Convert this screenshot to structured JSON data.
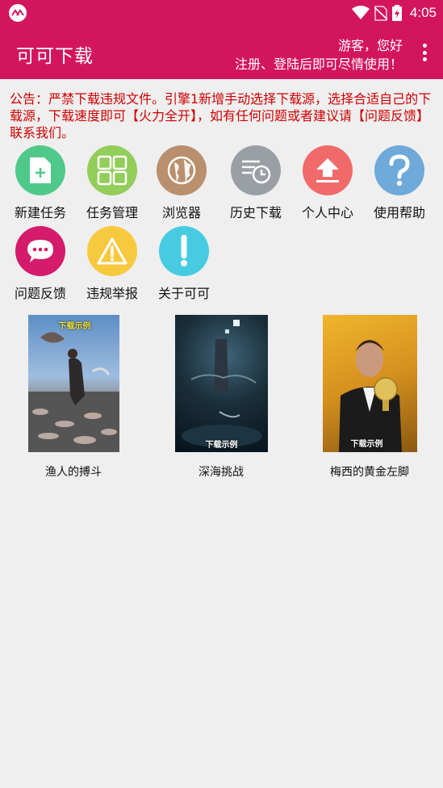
{
  "status_bar": {
    "time": "4:05",
    "icons": [
      "app-logo-icon",
      "wifi-icon",
      "no-sim-icon",
      "battery-charging-icon"
    ]
  },
  "app_bar": {
    "title": "可可下载",
    "greeting": "游客，您好",
    "login_hint": "注册、登陆后即可尽情使用！",
    "menu_icon": "more-vert-icon"
  },
  "notice": {
    "text": "公告：严禁下载违规文件。引擎1新增手动选择下载源，选择合适自己的下载源，下载速度即可【火力全开】，如有任何问题或者建议请【问题反馈】联系我们。"
  },
  "features": [
    {
      "label": "新建任务",
      "icon": "new-task-icon",
      "color": "#4fc98a"
    },
    {
      "label": "任务管理",
      "icon": "task-manage-icon",
      "color": "#93cd5a"
    },
    {
      "label": "浏览器",
      "icon": "globe-icon",
      "color": "#b98f6d"
    },
    {
      "label": "历史下载",
      "icon": "history-icon",
      "color": "#9a9fa6"
    },
    {
      "label": "个人中心",
      "icon": "upload-icon",
      "color": "#f06a6a"
    },
    {
      "label": "使用帮助",
      "icon": "help-icon",
      "color": "#6fa9d9"
    },
    {
      "label": "问题反馈",
      "icon": "feedback-icon",
      "color": "#d41b6c"
    },
    {
      "label": "违规举报",
      "icon": "warning-icon",
      "color": "#f7c93f"
    },
    {
      "label": "关于可可",
      "icon": "info-icon",
      "color": "#46cbe0"
    }
  ],
  "samples": [
    {
      "caption": "渔人的搏斗",
      "watermark": "下载示例"
    },
    {
      "caption": "深海挑战",
      "watermark": "下载示例"
    },
    {
      "caption": "梅西的黄金左脚",
      "watermark": "下载示例"
    }
  ]
}
